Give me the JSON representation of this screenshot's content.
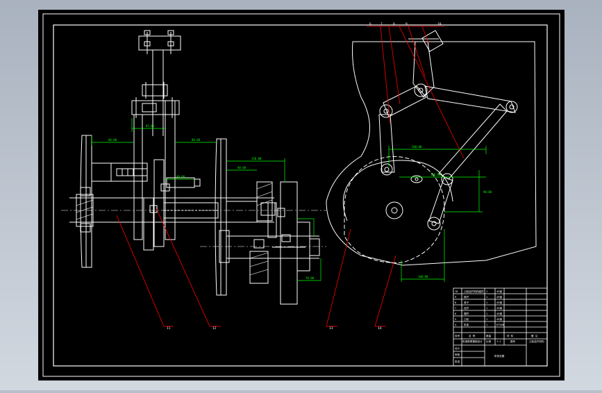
{
  "colors": {
    "background_gradient_top": "#a9b2bf",
    "background_gradient_bottom": "#d2d8e0",
    "sheet": "#000000",
    "line": "#ffffff",
    "dimension": "#00ff00",
    "leader": "#ff0000",
    "hidden": "#ffffff"
  },
  "balloons": {
    "top": [
      "6",
      "7",
      "8",
      "9",
      "10"
    ],
    "bottom": [
      "11",
      "12",
      "13",
      "14"
    ]
  },
  "dimensions": {
    "d1": "60.00",
    "d2": "80.00",
    "d3": "150.00",
    "d4": "65.00",
    "d5": "200.00",
    "d6": "40.00",
    "d7": "120.00",
    "d8": "90.00",
    "d9": "100.00",
    "d10": "40.00",
    "d11": "70.00"
  },
  "title_block": {
    "parts_rows": [
      [
        "10",
        "凸轮连杆机构组件",
        "1",
        "45钢"
      ],
      [
        "9",
        "推杆",
        "1",
        "45钢"
      ],
      [
        "8",
        "滚子",
        "1",
        "45钢"
      ],
      [
        "7",
        "连杆",
        "1",
        "45钢"
      ],
      [
        "6",
        "摆杆",
        "1",
        "45钢"
      ],
      [
        "5",
        "凸轮",
        "1",
        "45钢"
      ],
      [
        "4",
        "机架",
        "1",
        "HT200"
      ]
    ],
    "header_row": [
      "序号",
      "名 称",
      "数量",
      "材 料",
      "备 注"
    ],
    "drawing_title": "凸轮连杆机构",
    "scale_label": "比例",
    "scale_value": "1:1",
    "sheet_label": "图号",
    "design_label": "设计",
    "check_label": "审核",
    "approve_label": "批准",
    "school_label": "机械原理课程设计",
    "drawing_name": "机构总图"
  }
}
